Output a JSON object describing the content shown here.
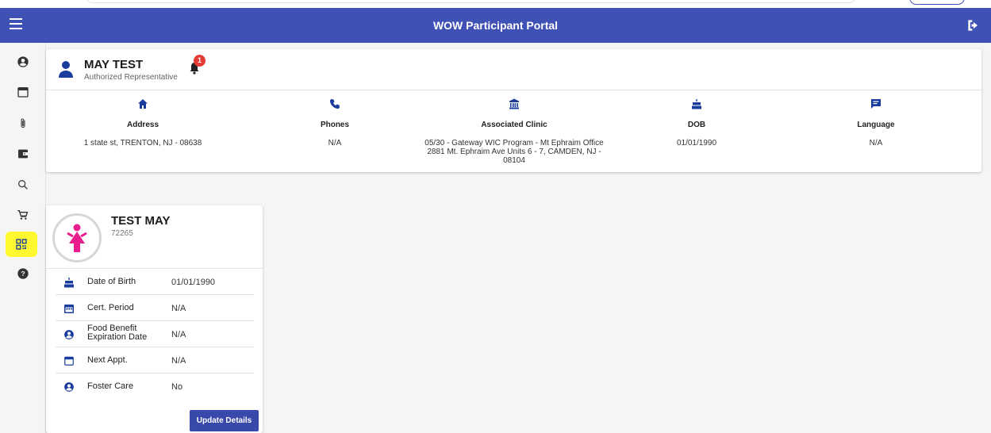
{
  "header": {
    "title": "WOW Participant Portal"
  },
  "colors": {
    "primary": "#3f51b5",
    "accent_female": "#e91e8c",
    "badge": "#e53935",
    "highlight": "#fff730",
    "icon_blue": "#1a3c9c"
  },
  "sidebar": {
    "items": [
      {
        "icon": "account-circle-icon"
      },
      {
        "icon": "calendar-icon"
      },
      {
        "icon": "paperclip-icon"
      },
      {
        "icon": "wallet-icon"
      },
      {
        "icon": "search-icon"
      },
      {
        "icon": "cart-icon"
      },
      {
        "icon": "qr-code-icon",
        "active": true
      },
      {
        "icon": "help-icon"
      }
    ]
  },
  "profile": {
    "name": "MAY TEST",
    "role": "Authorized Representative",
    "notification_count": "1",
    "info": [
      {
        "icon": "home-icon",
        "label": "Address",
        "value": "1 state st, TRENTON, NJ - 08638"
      },
      {
        "icon": "phone-icon",
        "label": "Phones",
        "value": "N/A"
      },
      {
        "icon": "bank-icon",
        "label": "Associated Clinic",
        "value_lines": [
          "05/30 - Gateway WIC Program - Mt Ephraim Office",
          "2881 Mt. Ephraim Ave Units 6 - 7, CAMDEN, NJ -",
          "08104"
        ]
      },
      {
        "icon": "cake-icon",
        "label": "DOB",
        "value": "01/01/1990"
      },
      {
        "icon": "message-icon",
        "label": "Language",
        "value": "N/A"
      }
    ]
  },
  "participant": {
    "name": "TEST MAY",
    "id": "72265",
    "details": [
      {
        "icon": "cake-icon",
        "label": "Date of Birth",
        "value": "01/01/1990"
      },
      {
        "icon": "calendar-event-icon",
        "label": "Cert. Period",
        "value": "N/A"
      },
      {
        "icon": "account-circle-icon",
        "label_lines": [
          "Food Benefit",
          "Expiration Date"
        ],
        "value": "N/A"
      },
      {
        "icon": "calendar-icon",
        "label": "Next Appt.",
        "value": "N/A"
      },
      {
        "icon": "account-circle-icon",
        "label": "Foster Care",
        "value": "No"
      }
    ],
    "update_button": "Update Details"
  }
}
